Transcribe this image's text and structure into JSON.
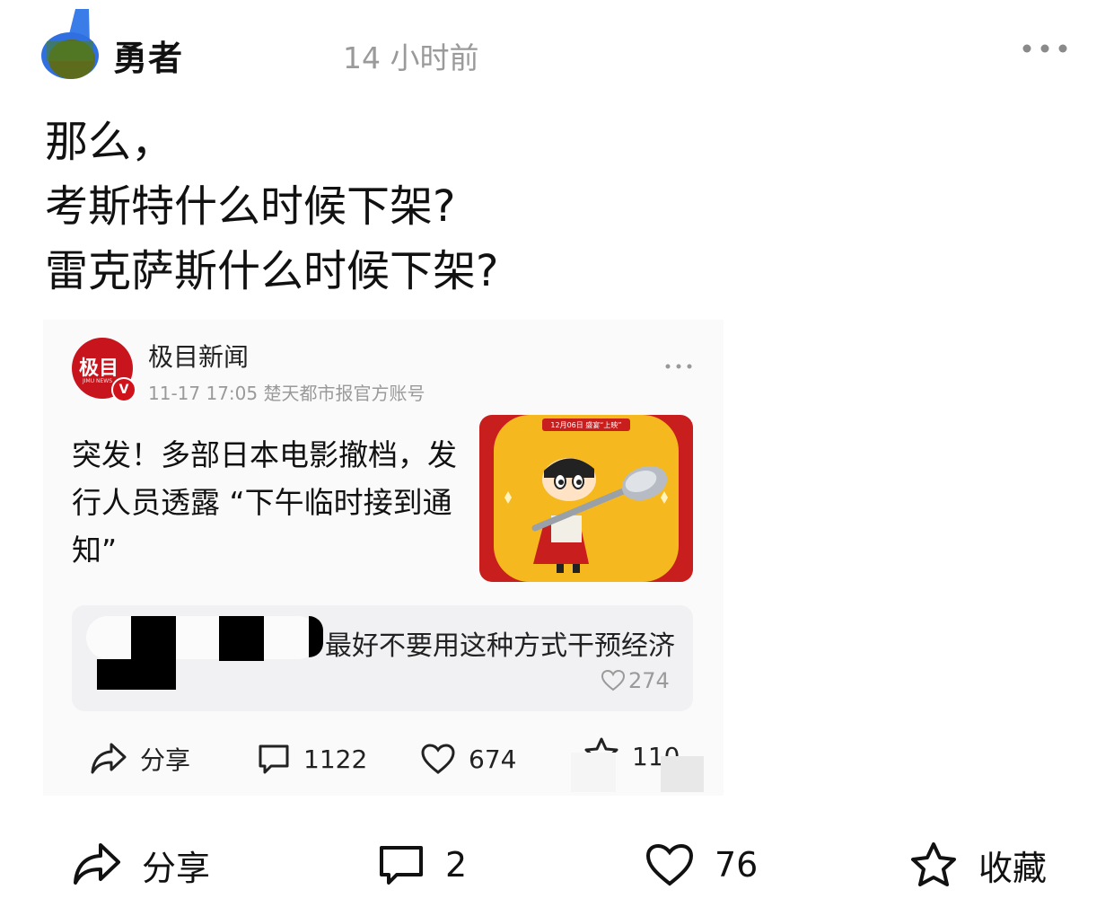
{
  "post": {
    "username": "勇者",
    "time_ago": "14 小时前",
    "lines": [
      "那么，",
      "考斯特什么时候下架?",
      "雷克萨斯什么时候下架?"
    ]
  },
  "embedded": {
    "source_logo": "极目",
    "source_logo_sub": "JIMU NEWS",
    "source_name": "极目新闻",
    "source_meta": "11-17 17:05  楚天都市报官方账号",
    "headline": "突发！多部日本电影撤档，发行人员透露 “下午临时接到通知”",
    "thumbnail_banner": "12月06日 盛宴“上映”",
    "comment_text": "最好不要用这种方式干预经济",
    "comment_likes": "274",
    "actions": {
      "share": "分享",
      "comments": "1122",
      "likes": "674",
      "favorites": "110"
    }
  },
  "actions": {
    "share": "分享",
    "comments": "2",
    "likes": "76",
    "favorite": "收藏"
  },
  "colors": {
    "brand_red": "#c8141c",
    "gray_text": "#9a9a9a",
    "thumbnail_yellow": "#f6b81f"
  }
}
